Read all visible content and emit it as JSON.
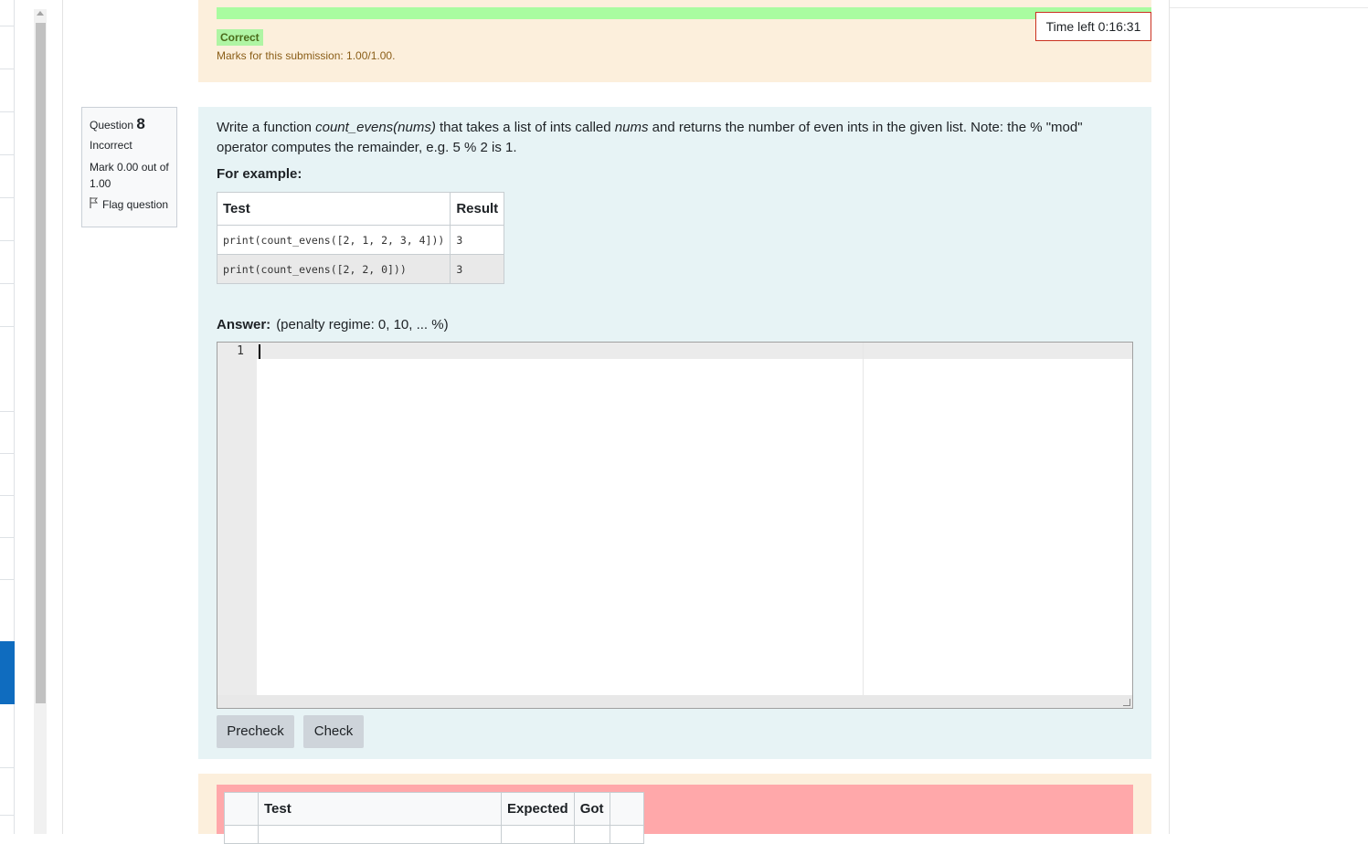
{
  "previous_question": {
    "outcome_badge": "Correct",
    "marks_text": "Marks for this submission: 1.00/1.00."
  },
  "timer": {
    "text": "Time left 0:16:31"
  },
  "question_info": {
    "label": "Question",
    "number": "8",
    "state": "Incorrect",
    "grade": "Mark 0.00 out of 1.00",
    "flag_label": "Flag question"
  },
  "question": {
    "text_part1": "Write a function ",
    "func_name": "count_evens(nums)",
    "text_part2": " that takes a list of ints called ",
    "param_name": "nums",
    "text_part3": " and returns the number of even ints in the given list. Note: the % \"mod\" operator computes the remainder, e.g. 5 % 2 is 1.",
    "for_example": "For example:",
    "examples_headers": [
      "Test",
      "Result"
    ],
    "examples": [
      {
        "test": "print(count_evens([2, 1, 2, 3, 4]))",
        "result": "3"
      },
      {
        "test": "print(count_evens([2, 2, 0]))",
        "result": "3"
      }
    ]
  },
  "answer": {
    "label": "Answer:",
    "penalty": "(penalty regime: 0, 10, ... %)",
    "line_number": "1"
  },
  "buttons": {
    "precheck": "Precheck",
    "check": "Check"
  },
  "results": {
    "headers": [
      "",
      "Test",
      "Expected",
      "Got",
      ""
    ]
  }
}
